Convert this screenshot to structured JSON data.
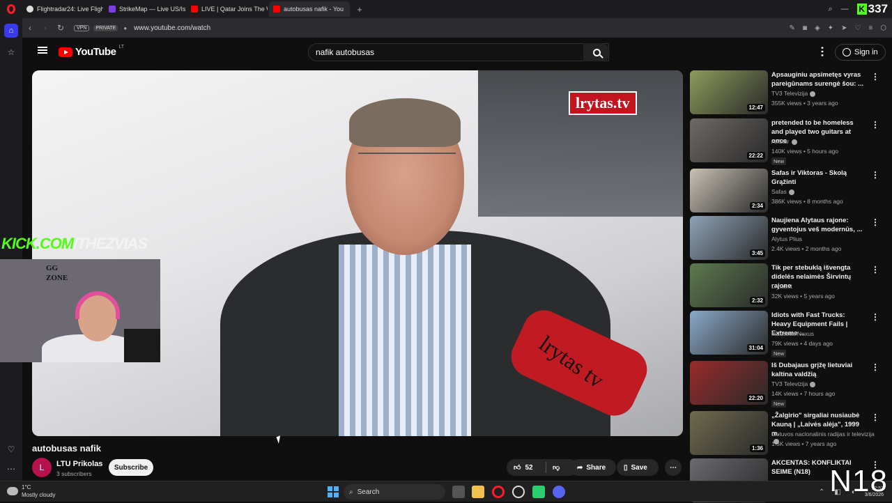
{
  "browser": {
    "tabs": [
      {
        "label": "Flightradar24: Live Flight T",
        "color": "#ffffff"
      },
      {
        "label": "StrikeMap — Live US/Isr",
        "color": "#7b3fe4"
      },
      {
        "label": "LIVE | Qatar Joins The WA",
        "color": "#ff0000"
      },
      {
        "label": "autobusas nafik - You",
        "color": "#ff0000"
      }
    ],
    "kick_count": "337",
    "vpn_label": "VPN",
    "private_label": "PRIVATE",
    "url": "www.youtube.com/watch"
  },
  "youtube": {
    "wordmark": "YouTube",
    "country": "LT",
    "search_value": "nafik autobusas",
    "signin_label": "Sign in"
  },
  "video": {
    "watermark": "lrytas.tv",
    "mic_label": "lrytas tv",
    "kick_overlay_green": "KICK.COM",
    "kick_overlay_rest": "/THEZVIAS",
    "webcam_text": "GG\nZONE",
    "title": "autobusas nafik",
    "channel": "LTU Prikolas",
    "channel_initial": "L",
    "subscribers": "3 subscribers",
    "subscribe_label": "Subscribe",
    "likes": "52",
    "share_label": "Share",
    "save_label": "Save"
  },
  "recommendations": [
    {
      "title": "Apsauginiu apsimetęs vyras pareigūnams surengė šou: ...",
      "channel": "TV3 Televizija",
      "verified": true,
      "meta": "355K views • 3 years ago",
      "duration": "12:47",
      "new": false,
      "thumb": "#8c9c5a"
    },
    {
      "title": "pretended to be homeless and played two guitars at once",
      "channel": "AkStar",
      "verified": true,
      "meta": "140K views • 5 hours ago",
      "duration": "22:22",
      "new": true,
      "thumb": "#6e6a66"
    },
    {
      "title": "Safas ir Viktoras - Skolą Grąžinti",
      "channel": "Safas",
      "verified": true,
      "meta": "386K views • 8 months ago",
      "duration": "2:34",
      "new": false,
      "thumb": "#c9c2b6"
    },
    {
      "title": "Naujiena Alytaus rajone: gyventojus veš modernūs, ...",
      "channel": "Alytus Plius",
      "verified": false,
      "meta": "2.4K views • 2 months ago",
      "duration": "3:45",
      "new": false,
      "thumb": "#8fa3b8"
    },
    {
      "title": "Tik per stebuklą išvengta didelės nelaimės Širvintų rajone",
      "channel": "Lrytas.lt",
      "verified": false,
      "meta": "32K views • 5 years ago",
      "duration": "2:32",
      "new": false,
      "thumb": "#5d7a4e"
    },
    {
      "title": "Idiots with Fast Trucks: Heavy Equipment Fails | Extreme ...",
      "channel": "Industrial Nexus",
      "verified": false,
      "meta": "79K views • 4 days ago",
      "duration": "31:04",
      "new": true,
      "thumb": "#8aa9c9"
    },
    {
      "title": "Iš Dubajaus grįžę lietuviai kaltina valdžią",
      "channel": "TV3 Televizija",
      "verified": true,
      "meta": "14K views • 7 hours ago",
      "duration": "22:20",
      "new": true,
      "thumb": "#9a2a2a"
    },
    {
      "title": "„Žalgirio\" sirgaliai nusiaubė Kauną | „Laivės alėja\", 1999 m.",
      "channel": "Lietuvos nacionalinis radijas ir televizija",
      "verified": true,
      "meta": "1.5K views • 7 years ago",
      "duration": "1:36",
      "new": false,
      "thumb": "#6f6a4e"
    },
    {
      "title": "AKCENTAS: KONFLIKTAI SEIME (N18)",
      "channel": "",
      "verified": false,
      "meta": "",
      "duration": "",
      "new": false,
      "thumb": "#6a6a70"
    }
  ],
  "new_label": "New",
  "taskbar": {
    "temperature": "1°C",
    "weather": "Mostly cloudy",
    "search_label": "Search",
    "time": "12:53",
    "date": "3/6/2026"
  },
  "n18_label": "N18"
}
